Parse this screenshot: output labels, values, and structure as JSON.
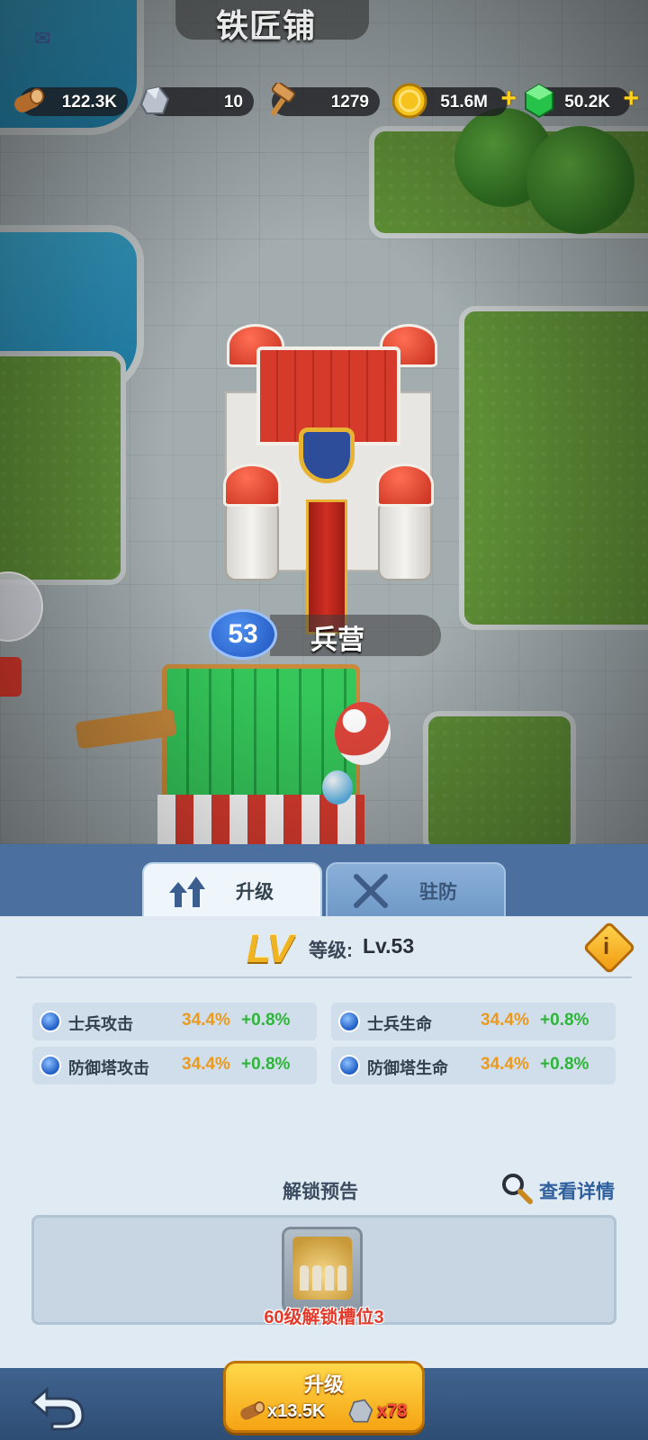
{
  "page_title": "铁匠铺",
  "resources": {
    "wood": {
      "icon": "wood-log-icon",
      "value": "122.3K"
    },
    "ore": {
      "icon": "ore-rock-icon",
      "value": "10"
    },
    "hammer": {
      "icon": "hammer-icon",
      "value": "1279"
    },
    "gold": {
      "icon": "gold-coin-icon",
      "value": "51.6M",
      "plus": "+"
    },
    "gem": {
      "icon": "green-gem-icon",
      "value": "50.2K",
      "plus": "+"
    }
  },
  "map": {
    "building_level": "53",
    "building_name": "兵营",
    "side_badge_icon": "red-notification-icon",
    "side_button_icon": "chat-icon"
  },
  "tabs": [
    {
      "label": "升级",
      "icon": "upgrade-arrows-icon",
      "active": true
    },
    {
      "label": "驻防",
      "icon": "crossed-swords-icon",
      "active": false
    }
  ],
  "level": {
    "logo": "LV",
    "label": "等级:",
    "value": "Lv.53"
  },
  "stats": [
    {
      "name": "士兵攻击",
      "base": "34.4%",
      "inc": "+0.8%"
    },
    {
      "name": "士兵生命",
      "base": "34.4%",
      "inc": "+0.8%"
    },
    {
      "name": "防御塔攻击",
      "base": "34.4%",
      "inc": "+0.8%"
    },
    {
      "name": "防御塔生命",
      "base": "34.4%",
      "inc": "+0.8%"
    }
  ],
  "unlock": {
    "title": "解锁预告",
    "details_link": "查看详情",
    "item_label": "60级解锁槽位3"
  },
  "footer": {
    "upgrade_label": "升级",
    "cost_wood": "x13.5K",
    "cost_ore": "x78"
  },
  "colors": {
    "accent_gold": "#f5a413",
    "stat_base": "#eb9a1e",
    "stat_increase": "#2fb43a",
    "warning_red": "#e23b2b",
    "panel_blue": "#4b6f9f"
  }
}
